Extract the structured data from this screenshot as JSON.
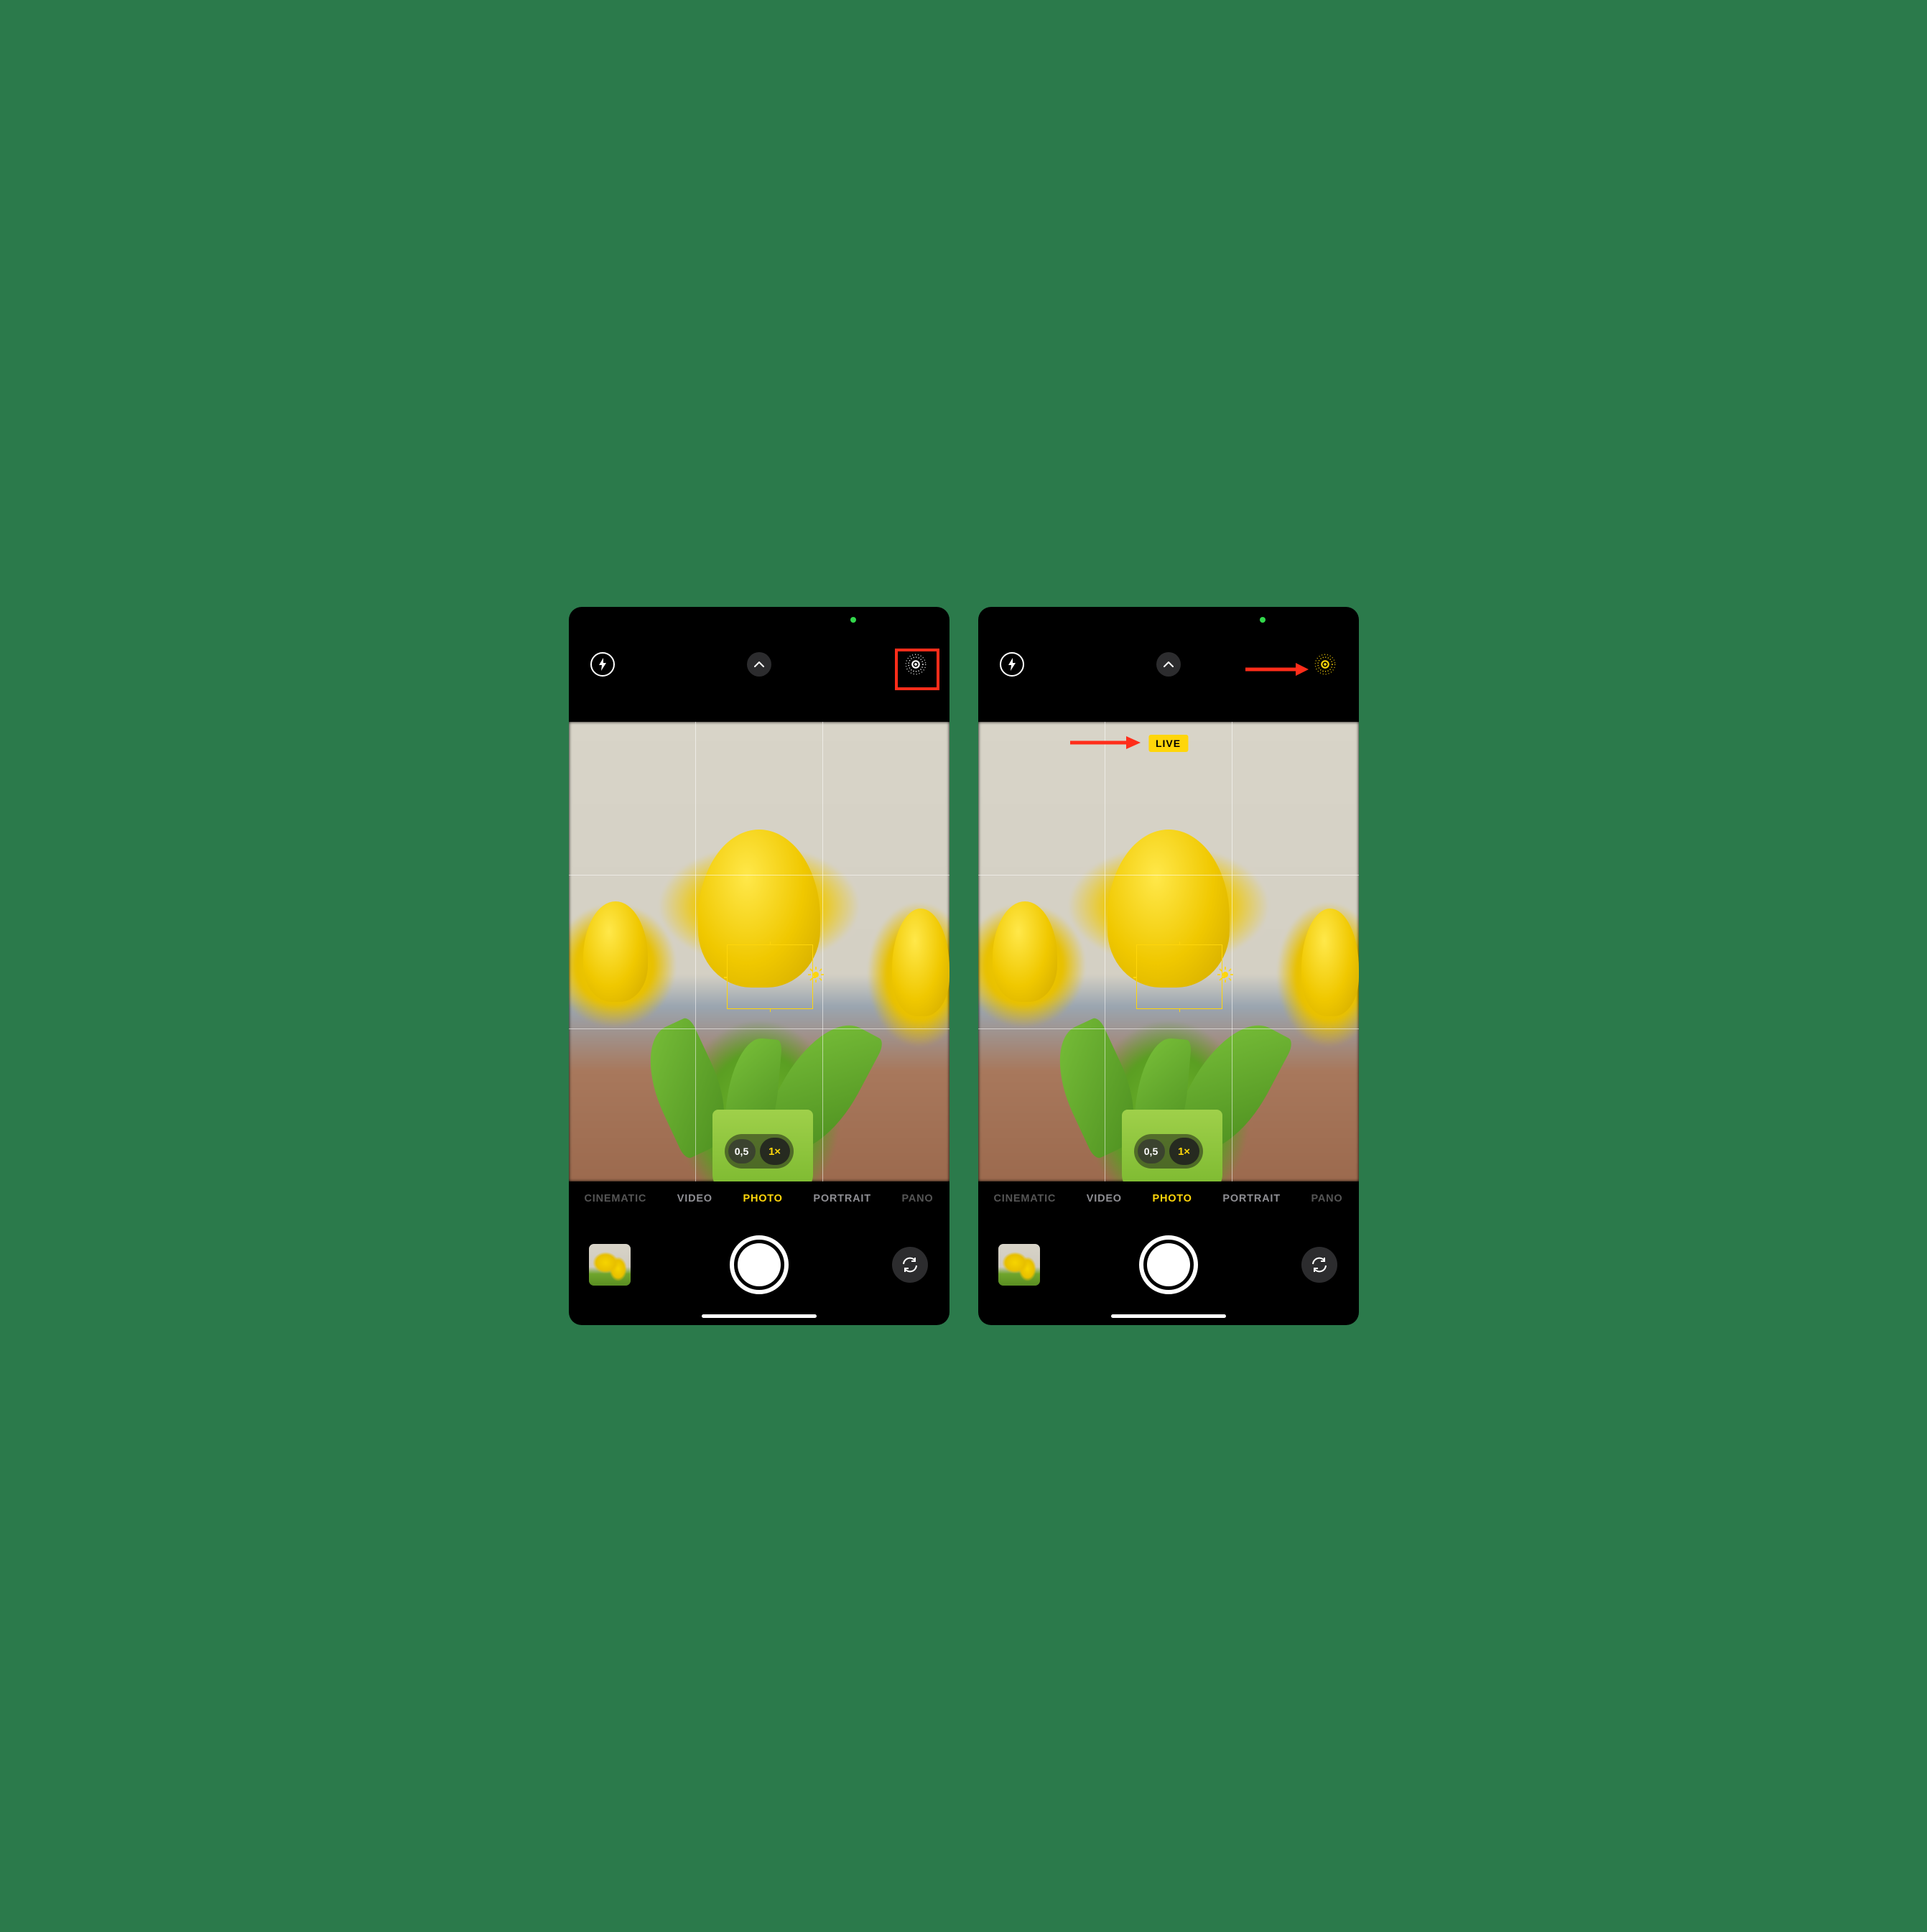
{
  "accent_yellow": "#ffd60a",
  "annotation_red": "#ff2d1a",
  "left": {
    "live_photo_active": false,
    "live_badge_text": null,
    "zoom": {
      "wide": "0,5",
      "main": "1×",
      "active": "1×"
    },
    "modes": [
      "CINEMATIC",
      "VIDEO",
      "PHOTO",
      "PORTRAIT",
      "PANO"
    ],
    "active_mode": "PHOTO"
  },
  "right": {
    "live_photo_active": true,
    "live_badge_text": "LIVE",
    "zoom": {
      "wide": "0,5",
      "main": "1×",
      "active": "1×"
    },
    "modes": [
      "CINEMATIC",
      "VIDEO",
      "PHOTO",
      "PORTRAIT",
      "PANO"
    ],
    "active_mode": "PHOTO"
  }
}
